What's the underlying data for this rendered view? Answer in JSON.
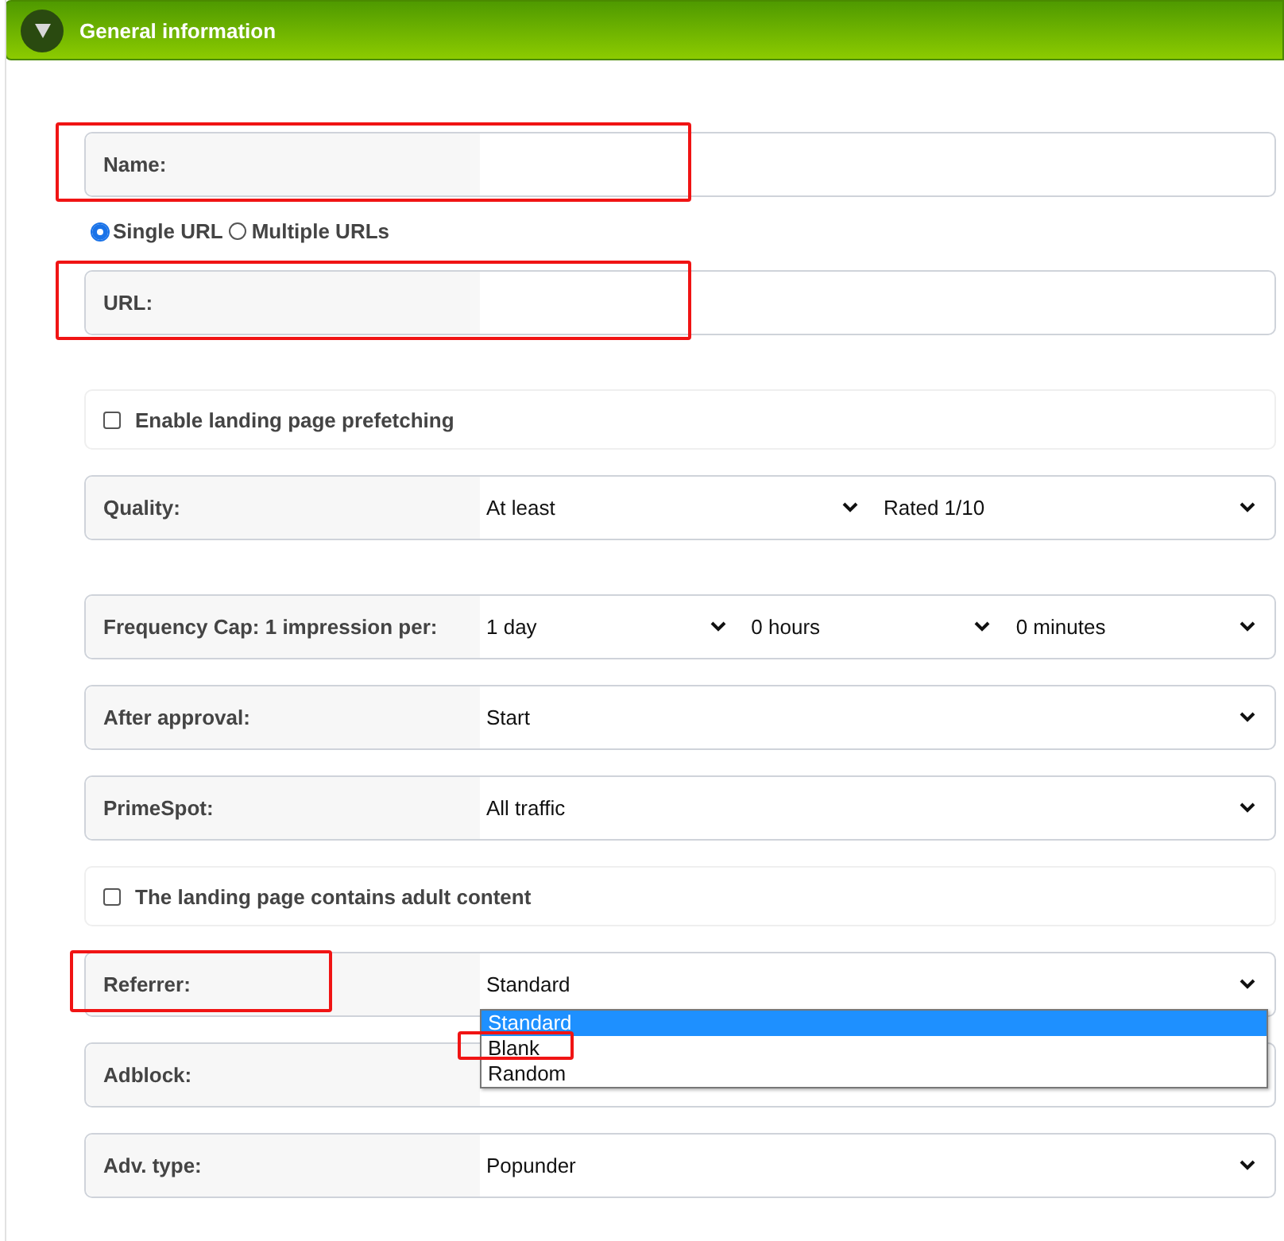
{
  "section": {
    "title": "General information",
    "expanded": true
  },
  "rows": [
    {
      "kind": "text",
      "label": "Name:",
      "value": "",
      "highlighted": true
    },
    {
      "kind": "radios",
      "options": [
        {
          "label": "Single URL",
          "selected": true
        },
        {
          "label": "Multiple URLs",
          "selected": false
        }
      ]
    },
    {
      "kind": "text",
      "label": "URL:",
      "value": "",
      "highlighted": true
    },
    {
      "kind": "checkbox",
      "label": "Enable landing page prefetching",
      "checked": false
    },
    {
      "kind": "select",
      "label": "Quality:",
      "selects": [
        "At least",
        "Rated 1/10"
      ]
    },
    {
      "kind": "select",
      "label": "Frequency Cap: 1 impression per:",
      "selects": [
        "1 day",
        "0 hours",
        "0 minutes"
      ]
    },
    {
      "kind": "select",
      "label": "After approval:",
      "selects": [
        "Start"
      ]
    },
    {
      "kind": "select",
      "label": "PrimeSpot:",
      "selects": [
        "All traffic"
      ]
    },
    {
      "kind": "checkbox",
      "label": "The landing page contains adult content",
      "checked": false
    },
    {
      "kind": "select",
      "label": "Referrer:",
      "selects": [
        "Standard"
      ],
      "highlighted": true,
      "dropdown": [
        {
          "label": "Standard",
          "selected": true,
          "highlighted": false
        },
        {
          "label": "Blank",
          "selected": false,
          "highlighted": true
        },
        {
          "label": "Random",
          "selected": false,
          "highlighted": false
        }
      ]
    },
    {
      "kind": "select",
      "label": "Adblock:",
      "selects": []
    },
    {
      "kind": "select",
      "label": "Adv. type:",
      "selects": [
        "Popunder"
      ]
    }
  ]
}
